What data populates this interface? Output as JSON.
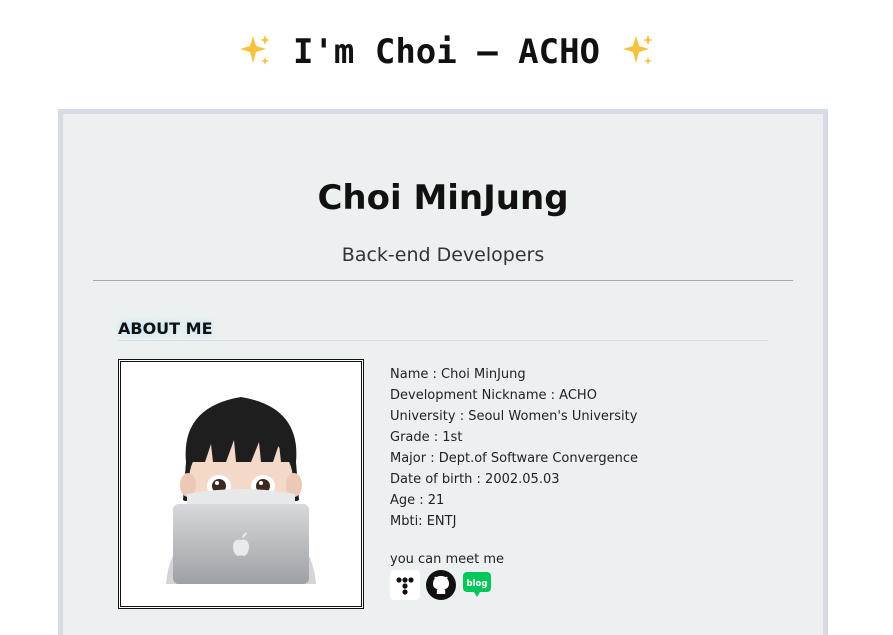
{
  "header": {
    "sparkle_left": "✨",
    "title": "I'm Choi — ACHO",
    "sparkle_right": "✨"
  },
  "profile": {
    "name": "Choi MinJung",
    "role": "Back-end Developers"
  },
  "about": {
    "title": "ABOUT ME",
    "avatar_icon": "memoji-laptop-avatar",
    "lines": [
      "Name : Choi MinJung",
      "Development Nickname : ACHO",
      "University : Seoul Women's University",
      "Grade : 1st",
      "Major : Dept.of Software Convergence",
      "Date of birth : 2002.05.03",
      "Age : 21",
      "Mbti: ENTJ"
    ],
    "meet_label": "you can meet me",
    "social": [
      {
        "icon": "tistory-icon",
        "color": "#111111"
      },
      {
        "icon": "github-icon",
        "color": "#111111"
      },
      {
        "icon": "naver-blog-icon",
        "color": "#03c75a",
        "text": "blog"
      }
    ]
  },
  "colors": {
    "card_background": "#edf0f1",
    "card_border": "#d6dbe6",
    "sparkle": "#f6c23e"
  }
}
